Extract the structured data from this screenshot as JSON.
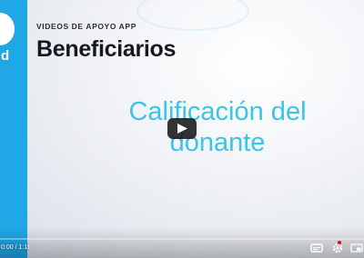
{
  "video": {
    "kicker": "VIDEOS DE APOYO APP",
    "title": "Beneficiarios",
    "subtitle_line1": "Calificación del",
    "subtitle_line2": "donante",
    "sidebar_letter": "d"
  },
  "player": {
    "time_display": "0:00 / 1:16",
    "progress_fraction": 0.0,
    "icons": [
      "play-icon",
      "captions-icon",
      "gear-icon",
      "miniplayer-icon"
    ],
    "colors": {
      "sidebar": "#20a8e6",
      "subtitle": "#3cc3e8",
      "progress": "#ff0000"
    }
  }
}
